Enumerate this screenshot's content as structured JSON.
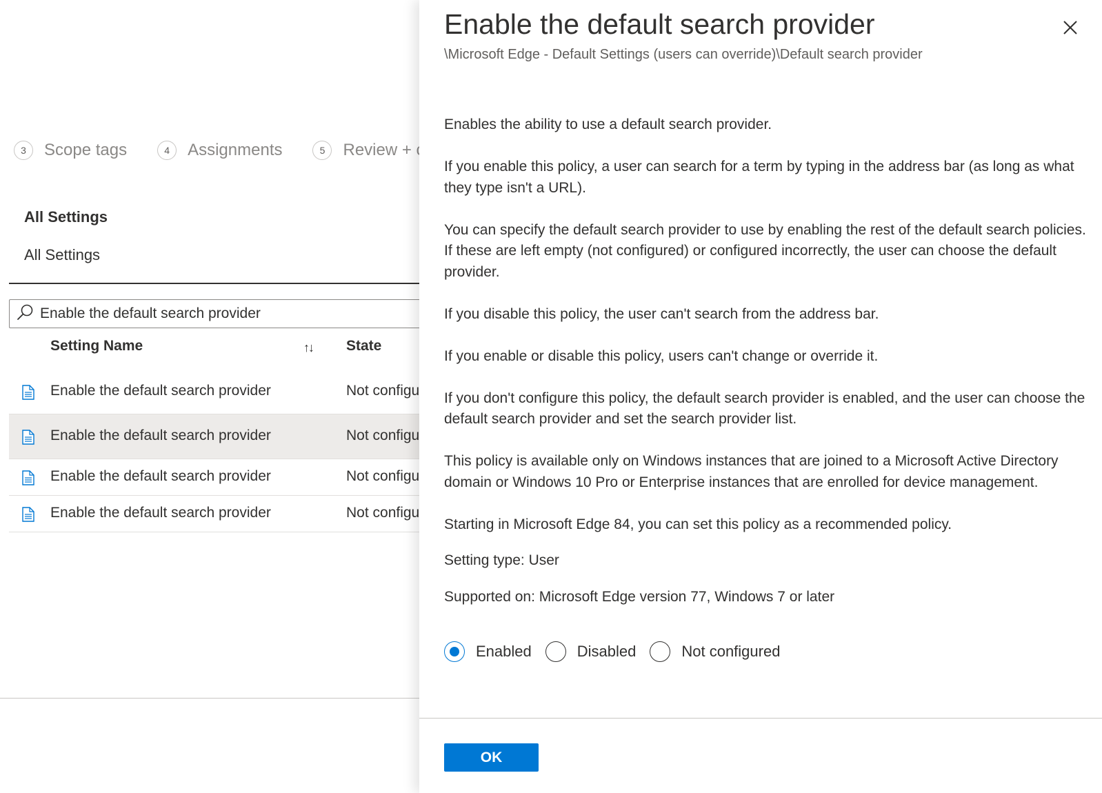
{
  "wizard": {
    "steps": [
      {
        "number": "3",
        "label": "Scope tags"
      },
      {
        "number": "4",
        "label": "Assignments"
      },
      {
        "number": "5",
        "label": "Review + c"
      }
    ]
  },
  "settings_section": {
    "title": "All Settings",
    "subtitle": "All Settings"
  },
  "search": {
    "value": "Enable the default search provider",
    "icon": "search-icon"
  },
  "table": {
    "columns": [
      "Setting Name",
      "State"
    ],
    "sort_icon": "sort-ascending-icon",
    "rows": [
      {
        "name": "Enable the default search provider",
        "state": "Not configu",
        "selected": false
      },
      {
        "name": "Enable the default search provider",
        "state": "Not configu",
        "selected": true
      },
      {
        "name": "Enable the default search provider",
        "state": "Not configu",
        "selected": false
      },
      {
        "name": "Enable the default search provider",
        "state": "Not configu",
        "selected": false
      }
    ]
  },
  "panel": {
    "title": "Enable the default search provider",
    "path": "\\Microsoft Edge - Default Settings (users can override)\\Default search provider",
    "close_icon": "close-icon",
    "description": [
      "Enables the ability to use a default search provider.",
      "If you enable this policy, a user can search for a term by typing in the address bar (as long as what they type isn't a URL).",
      "You can specify the default search provider to use by enabling the rest of the default search policies. If these are left empty (not configured) or configured incorrectly, the user can choose the default provider.",
      "If you disable this policy, the user can't search from the address bar.",
      "If you enable or disable this policy, users can't change or override it.",
      "If you don't configure this policy, the default search provider is enabled, and the user can choose the default search provider and set the search provider list.",
      "This policy is available only on Windows instances that are joined to a Microsoft Active Directory domain or Windows 10 Pro or Enterprise instances that are enrolled for device management.",
      "Starting in Microsoft Edge 84, you can set this policy as a recommended policy.",
      "Setting type: User",
      "Supported on: Microsoft Edge version 77, Windows 7 or later"
    ],
    "radio_options": [
      {
        "label": "Enabled",
        "checked": true
      },
      {
        "label": "Disabled",
        "checked": false
      },
      {
        "label": "Not configured",
        "checked": false
      }
    ],
    "ok_label": "OK"
  },
  "colors": {
    "accent": "#0078d4",
    "selected_row": "#edebe9",
    "text": "#323130",
    "muted": "#8a8886"
  }
}
